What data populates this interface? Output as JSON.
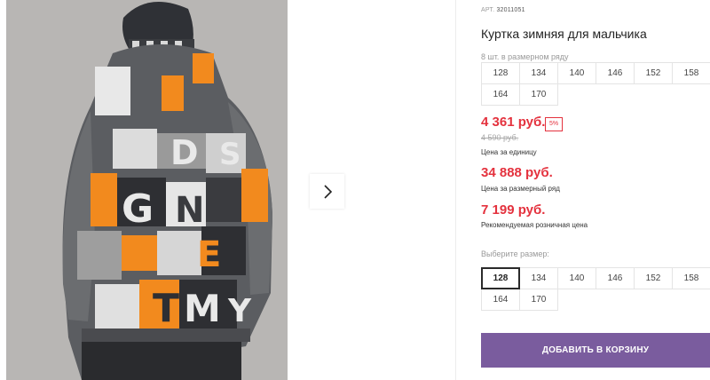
{
  "product": {
    "sku_label": "АРТ.",
    "sku_value": "32011051",
    "title": "Куртка зимняя для мальчика"
  },
  "size_row": {
    "label": "8 шт. в размерном ряду",
    "sizes": [
      "128",
      "134",
      "140",
      "146",
      "152",
      "158",
      "164",
      "170"
    ]
  },
  "pricing": {
    "unit_price": "4 361 руб.",
    "discount": "5%",
    "old_price": "4 590 руб.",
    "unit_caption": "Цена за единицу",
    "row_price": "34 888 руб.",
    "row_caption": "Цена за размерный ряд",
    "retail_price": "7 199 руб.",
    "retail_caption": "Рекомендуемая розничная цена"
  },
  "size_picker": {
    "label": "Выберите размер:",
    "options": [
      "128",
      "134",
      "140",
      "146",
      "152",
      "158",
      "164",
      "170"
    ],
    "selected": "128"
  },
  "cart": {
    "add_label": "ДОБАВИТЬ В КОРЗИНУ"
  },
  "gallery": {
    "next_icon": "chevron-right-icon",
    "photo_text": [
      "D",
      "S",
      "G",
      "N",
      "E",
      "T",
      "M",
      "Y"
    ]
  },
  "colors": {
    "accent_button": "#7a5c9e",
    "price_red": "#e4323e"
  }
}
